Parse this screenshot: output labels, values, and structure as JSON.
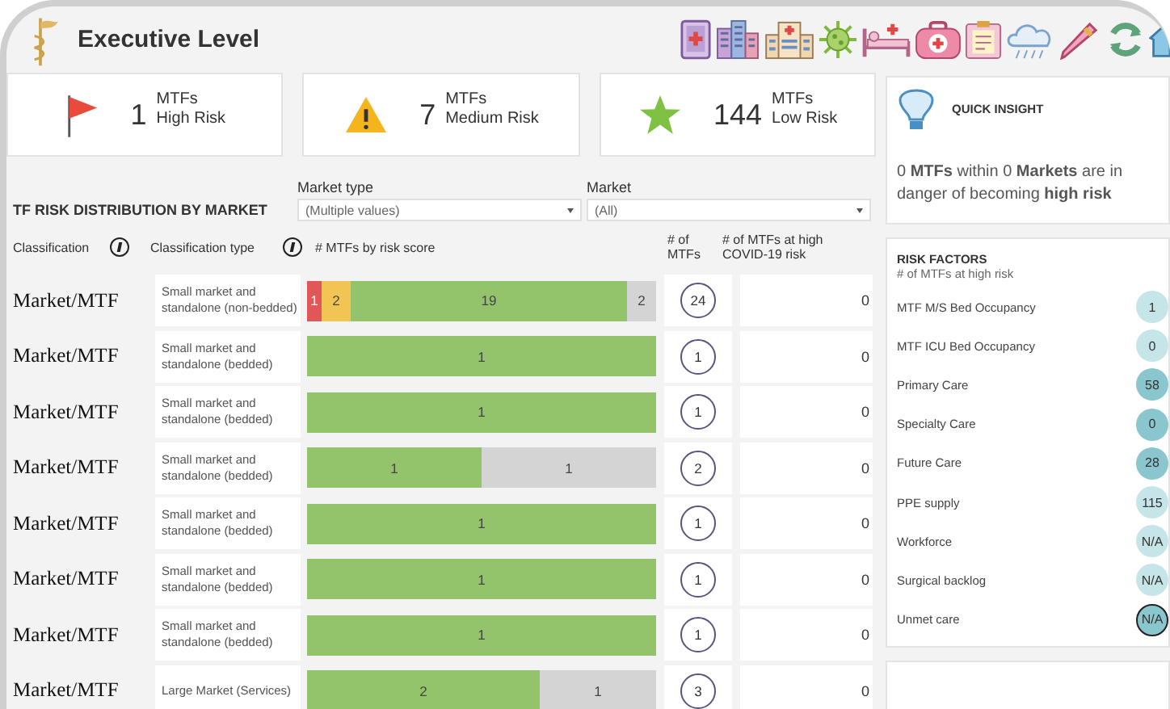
{
  "header": {
    "title": "Executive Level"
  },
  "kpis": [
    {
      "kind": "flag",
      "count": "1",
      "unit": "MTFs",
      "label": "High Risk"
    },
    {
      "kind": "warning",
      "count": "7",
      "unit": "MTFs",
      "label": "Medium Risk"
    },
    {
      "kind": "star",
      "count": "144",
      "unit": "MTFs",
      "label": "Low Risk"
    }
  ],
  "distribution": {
    "title": "TF RISK DISTRIBUTION BY MARKET",
    "filters": [
      {
        "label": "Market type",
        "value": "(Multiple values)"
      },
      {
        "label": "Market",
        "value": "(All)"
      }
    ],
    "columns": [
      "Classification",
      "Classification type",
      "# MTFs by risk score",
      "# of MTFs",
      "# of MTFs at high COVID-19 risk"
    ],
    "rows": [
      {
        "classification": "Market/MTF",
        "type": "Small market and standalone (non-bedded)",
        "segments": [
          {
            "kind": "high",
            "value": "1"
          },
          {
            "kind": "medium",
            "value": "2"
          },
          {
            "kind": "low",
            "value": "19"
          },
          {
            "kind": "none",
            "value": "2"
          }
        ],
        "mtfs": "24",
        "covid": "0"
      },
      {
        "classification": "Market/MTF",
        "type": "Small market and standalone (bedded)",
        "segments": [
          {
            "kind": "low",
            "value": "1"
          }
        ],
        "mtfs": "1",
        "covid": "0"
      },
      {
        "classification": "Market/MTF",
        "type": "Small market and standalone (bedded)",
        "segments": [
          {
            "kind": "low",
            "value": "1"
          }
        ],
        "mtfs": "1",
        "covid": "0"
      },
      {
        "classification": "Market/MTF",
        "type": "Small market and standalone (bedded)",
        "segments": [
          {
            "kind": "low",
            "value": "1"
          },
          {
            "kind": "none",
            "value": "1"
          }
        ],
        "mtfs": "2",
        "covid": "0"
      },
      {
        "classification": "Market/MTF",
        "type": "Small market and standalone (bedded)",
        "segments": [
          {
            "kind": "low",
            "value": "1"
          }
        ],
        "mtfs": "1",
        "covid": "0"
      },
      {
        "classification": "Market/MTF",
        "type": "Small market and standalone (bedded)",
        "segments": [
          {
            "kind": "low",
            "value": "1"
          }
        ],
        "mtfs": "1",
        "covid": "0"
      },
      {
        "classification": "Market/MTF",
        "type": "Small market and standalone (bedded)",
        "segments": [
          {
            "kind": "low",
            "value": "1"
          }
        ],
        "mtfs": "1",
        "covid": "0"
      },
      {
        "classification": "Market/MTF",
        "type": "Large Market (Services)",
        "segments": [
          {
            "kind": "low",
            "value": "2"
          },
          {
            "kind": "none",
            "value": "1"
          }
        ],
        "mtfs": "3",
        "covid": "0"
      }
    ]
  },
  "insight": {
    "title": "QUICK INSIGHT",
    "text": "0 **MTFs** within 0 **Markets** are in danger of becoming **high risk**"
  },
  "risk_factors": {
    "title": "RISK FACTORS",
    "subtitle": "# of MTFs at high risk",
    "items": [
      {
        "label": "MTF M/S Bed Occupancy",
        "value": "1",
        "color": "#c5e5e8",
        "selected": false
      },
      {
        "label": "MTF ICU Bed Occupancy",
        "value": "0",
        "color": "#c5e5e8",
        "selected": false
      },
      {
        "label": "Primary Care",
        "value": "58",
        "color": "#8ac6cd",
        "selected": false
      },
      {
        "label": "Specialty Care",
        "value": "0",
        "color": "#8ac6cd",
        "selected": false
      },
      {
        "label": "Future Care",
        "value": "28",
        "color": "#8ac6cd",
        "selected": false
      },
      {
        "label": "PPE supply",
        "value": "115",
        "color": "#c5e5e8",
        "selected": false
      },
      {
        "label": "Workforce",
        "value": "N/A",
        "color": "#c5e5e8",
        "selected": false
      },
      {
        "label": "Surgical backlog",
        "value": "N/A",
        "color": "#c5e5e8",
        "selected": false
      },
      {
        "label": "Unmet care",
        "value": "N/A",
        "color": "#8ac6cd",
        "selected": true
      }
    ]
  }
}
